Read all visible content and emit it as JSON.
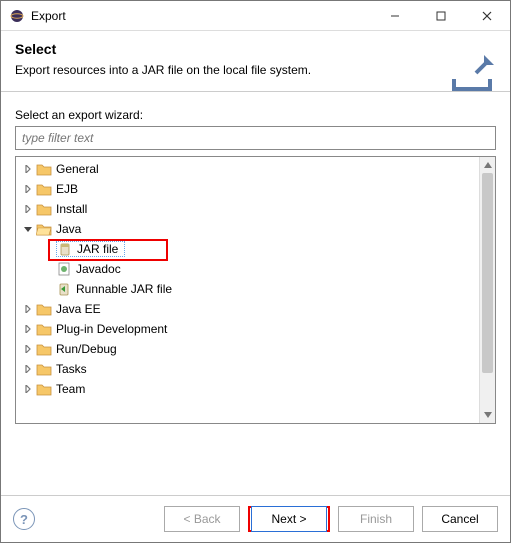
{
  "titlebar": {
    "title": "Export"
  },
  "banner": {
    "heading": "Select",
    "description": "Export resources into a JAR file on the local file system."
  },
  "content": {
    "label": "Select an export wizard:",
    "filter_placeholder": "type filter text"
  },
  "tree": {
    "items": [
      {
        "label": "General",
        "expanded": false
      },
      {
        "label": "EJB",
        "expanded": false
      },
      {
        "label": "Install",
        "expanded": false
      },
      {
        "label": "Java",
        "expanded": true,
        "children": [
          {
            "label": "JAR file",
            "selected": true
          },
          {
            "label": "Javadoc"
          },
          {
            "label": "Runnable JAR file"
          }
        ]
      },
      {
        "label": "Java EE",
        "expanded": false
      },
      {
        "label": "Plug-in Development",
        "expanded": false
      },
      {
        "label": "Run/Debug",
        "expanded": false
      },
      {
        "label": "Tasks",
        "expanded": false
      },
      {
        "label": "Team",
        "expanded": false
      }
    ]
  },
  "buttons": {
    "back": "< Back",
    "next": "Next >",
    "finish": "Finish",
    "cancel": "Cancel"
  }
}
